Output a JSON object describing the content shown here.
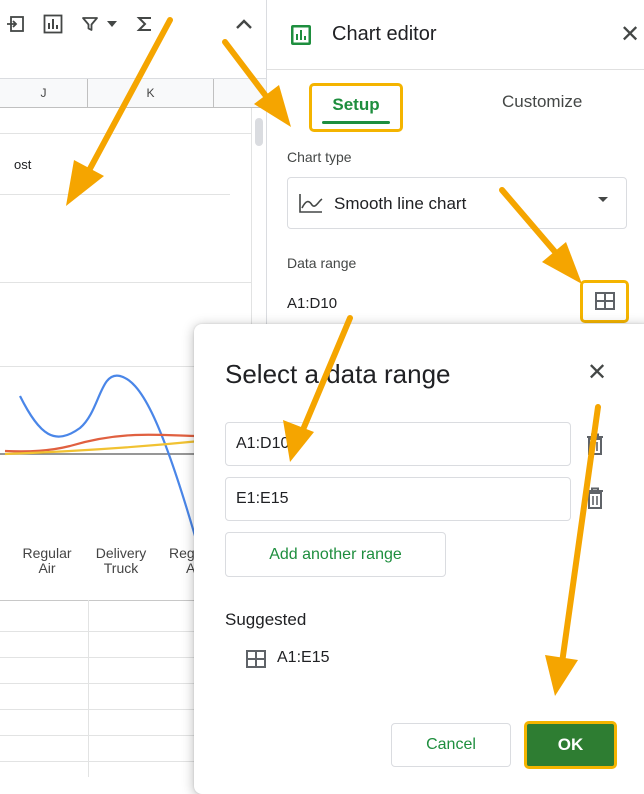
{
  "sheet": {
    "columns": [
      "J",
      "K"
    ],
    "cell_text": "ost",
    "chart_x_categories": [
      {
        "line1": "Regular",
        "line2": "Air"
      },
      {
        "line1": "Delivery",
        "line2": "Truck"
      },
      {
        "line1": "Reg",
        "line2": "A"
      }
    ],
    "series_colors": [
      "#4a86e8",
      "#e06040",
      "#f1c232"
    ]
  },
  "editor": {
    "title": "Chart editor",
    "tabs": {
      "setup": "Setup",
      "customize": "Customize"
    },
    "chart_type_label": "Chart type",
    "chart_type_value": "Smooth line chart",
    "data_range_label": "Data range",
    "data_range_value": "A1:D10"
  },
  "dialog": {
    "title": "Select a data range",
    "ranges": [
      "A1:D10",
      "E1:E15"
    ],
    "add_range_label": "Add another range",
    "suggested_label": "Suggested",
    "suggestion": "A1:E15",
    "cancel_label": "Cancel",
    "ok_label": "OK"
  },
  "colors": {
    "accent_green": "#1e8e3e",
    "ok_green": "#2e7d32",
    "highlight_orange": "#f4b400"
  }
}
